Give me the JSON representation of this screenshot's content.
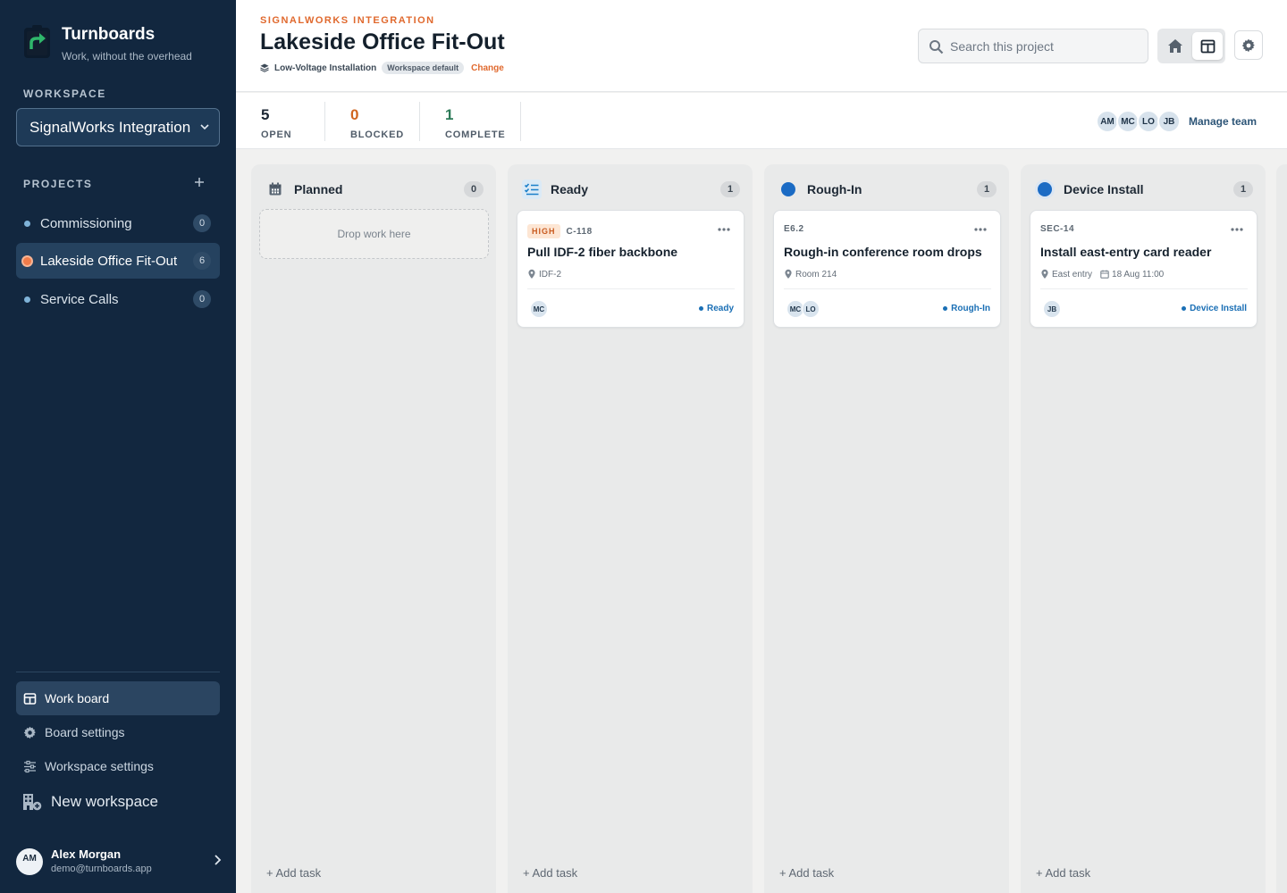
{
  "brand": {
    "name": "Turnboards",
    "tagline": "Work, without the overhead"
  },
  "sidebar": {
    "workspace_label": "WORKSPACE",
    "workspace_selected": "SignalWorks Integration",
    "projects_label": "PROJECTS",
    "projects": [
      {
        "label": "Commissioning",
        "count": "0",
        "active": false
      },
      {
        "label": "Lakeside Office Fit-Out",
        "count": "6",
        "active": true
      },
      {
        "label": "Service Calls",
        "count": "0",
        "active": false
      }
    ],
    "nav": [
      {
        "label": "Work board",
        "icon": "board-icon",
        "active": true
      },
      {
        "label": "Board settings",
        "icon": "gear-icon",
        "active": false
      },
      {
        "label": "Workspace settings",
        "icon": "sliders-icon",
        "active": false
      },
      {
        "label": "New workspace",
        "icon": "building-plus-icon",
        "active": false
      }
    ],
    "user": {
      "initials": "AM",
      "name": "Alex Morgan",
      "email": "demo@turnboards.app"
    }
  },
  "header": {
    "eyebrow": "SIGNALWORKS INTEGRATION",
    "title": "Lakeside Office Fit-Out",
    "board_type": "Low-Voltage Installation",
    "board_type_pill": "Workspace default",
    "change_label": "Change",
    "search_placeholder": "Search this project"
  },
  "stats": [
    {
      "value": "5",
      "label": "OPEN",
      "color": "#1b2633"
    },
    {
      "value": "0",
      "label": "BLOCKED",
      "color": "#d0651f"
    },
    {
      "value": "1",
      "label": "COMPLETE",
      "color": "#2c7a57"
    }
  ],
  "team": {
    "members": [
      "AM",
      "MC",
      "LO",
      "JB"
    ],
    "manage_label": "Manage team"
  },
  "board": {
    "add_task_label": "+ Add task",
    "drop_label": "Drop work here",
    "columns": [
      {
        "title": "Planned",
        "count": "0",
        "icon": "calendar-icon"
      },
      {
        "title": "Ready",
        "count": "1",
        "icon": "checklist-icon"
      },
      {
        "title": "Rough-In",
        "count": "1",
        "icon": "circle-icon"
      },
      {
        "title": "Device Install",
        "count": "1",
        "icon": "circle-icon"
      }
    ],
    "cards": [
      {
        "priority": "HIGH",
        "code": "C-118",
        "title": "Pull IDF-2 fiber backbone",
        "location": "IDF-2",
        "date": "",
        "assignees": [
          "MC"
        ],
        "status": "Ready"
      },
      {
        "priority": "",
        "code": "E6.2",
        "title": "Rough-in conference room drops",
        "location": "Room 214",
        "date": "",
        "assignees": [
          "MC",
          "LO"
        ],
        "status": "Rough-In"
      },
      {
        "priority": "",
        "code": "SEC-14",
        "title": "Install east-entry card reader",
        "location": "East entry",
        "date": "18 Aug 11:00",
        "assignees": [
          "JB"
        ],
        "status": "Device Install"
      }
    ]
  },
  "colors": {
    "accent": "#e0692e",
    "sidebar": "#12273f",
    "status_blue": "#1a6fb5"
  }
}
